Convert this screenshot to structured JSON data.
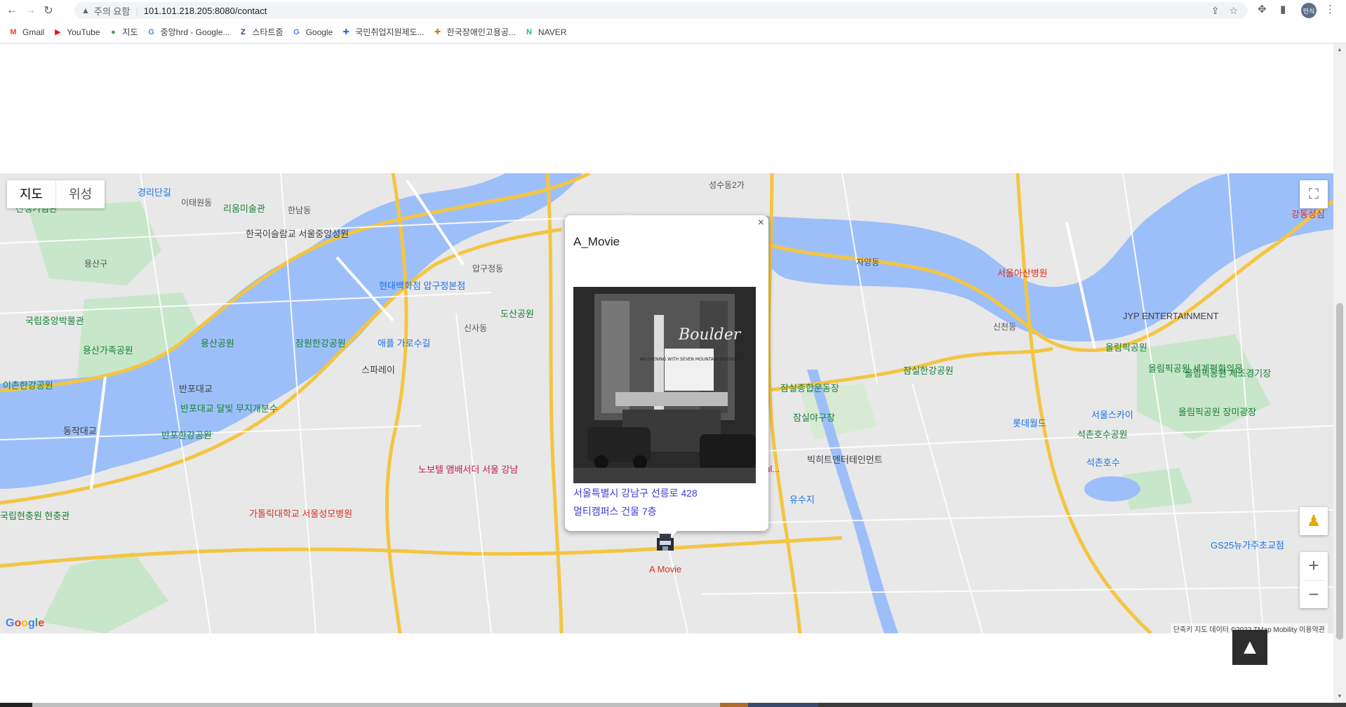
{
  "browser": {
    "security_label": "주의 요함",
    "url": "101.101.218.205:8080/contact",
    "avatar_text": "민식",
    "bookmarks": [
      {
        "label": "Gmail",
        "icon": "gmail-icon",
        "color": "#ea4335",
        "glyph": "M"
      },
      {
        "label": "YouTube",
        "icon": "youtube-icon",
        "color": "#ff0000",
        "glyph": "▶"
      },
      {
        "label": "지도",
        "icon": "maps-icon",
        "color": "#34a853",
        "glyph": "●"
      },
      {
        "label": "중앙hrd - Google...",
        "icon": "google-icon",
        "color": "#4285f4",
        "glyph": "G"
      },
      {
        "label": "스타트줌",
        "icon": "startzoom-icon",
        "color": "#1a3c8c",
        "glyph": "Z"
      },
      {
        "label": "Google",
        "icon": "google-icon",
        "color": "#4285f4",
        "glyph": "G"
      },
      {
        "label": "국민취업지원제도...",
        "icon": "gov-icon",
        "color": "#1a73e8",
        "glyph": "✚"
      },
      {
        "label": "한국장애인고용공...",
        "icon": "kead-icon",
        "color": "#e37400",
        "glyph": "✚"
      },
      {
        "label": "NAVER",
        "icon": "naver-icon",
        "color": "#03c75a",
        "glyph": "N"
      }
    ]
  },
  "map": {
    "type_controls": {
      "map": "지도",
      "satellite": "위성"
    },
    "colors": {
      "water": "#9dbff9",
      "land": "#e8e8e8",
      "park": "#c8e6c9",
      "road_major": "#f4c542",
      "road_minor": "#ffffff"
    },
    "labels": [
      {
        "text": "경리단길",
        "cls": "blue"
      },
      {
        "text": "이태원동",
        "cls": ""
      },
      {
        "text": "리움미술관",
        "cls": "green"
      },
      {
        "text": "전쟁기념관",
        "cls": "green"
      },
      {
        "text": "한국이슬람교 서울중앙성원",
        "cls": "dark"
      },
      {
        "text": "한남동",
        "cls": ""
      },
      {
        "text": "용산구",
        "cls": ""
      },
      {
        "text": "국립중앙박물관",
        "cls": "green"
      },
      {
        "text": "용산공원",
        "cls": "green"
      },
      {
        "text": "용산가족공원",
        "cls": "green"
      },
      {
        "text": "이촌한강공원",
        "cls": "green"
      },
      {
        "text": "잠원한강공원",
        "cls": "green"
      },
      {
        "text": "현대백화점 압구정본점",
        "cls": "blue"
      },
      {
        "text": "도산공원",
        "cls": "green"
      },
      {
        "text": "애플 가로수길",
        "cls": "blue"
      },
      {
        "text": "스파레이",
        "cls": "dark"
      },
      {
        "text": "반포대교 달빛 무지개분수",
        "cls": "green"
      },
      {
        "text": "반포한강공원",
        "cls": "green"
      },
      {
        "text": "동작대교",
        "cls": "dark"
      },
      {
        "text": "반포대교",
        "cls": "dark"
      },
      {
        "text": "노보텔 앰배서더 서울 강남",
        "cls": "pink"
      },
      {
        "text": "Josun Palace, a Luxury Collection Hotel, Seoul...",
        "cls": "pink"
      },
      {
        "text": "가톨릭대학교 서울성모병원",
        "cls": "red"
      },
      {
        "text": "국립현충원 현충관",
        "cls": "green"
      },
      {
        "text": "잠실한강공원",
        "cls": "green"
      },
      {
        "text": "잠실종합운동장",
        "cls": "green"
      },
      {
        "text": "잠실야구장",
        "cls": "green"
      },
      {
        "text": "빅히트엔터테인먼트",
        "cls": "dark"
      },
      {
        "text": "롯데월드",
        "cls": "blue"
      },
      {
        "text": "서울스카이",
        "cls": "blue"
      },
      {
        "text": "석촌호수공원",
        "cls": "green"
      },
      {
        "text": "서울아산병원",
        "cls": "red"
      },
      {
        "text": "JYP ENTERTAINMENT",
        "cls": "dark"
      },
      {
        "text": "올림픽공원",
        "cls": "green"
      },
      {
        "text": "올림픽공원 세계평화의문",
        "cls": "green"
      },
      {
        "text": "올림픽공원 체조경기장",
        "cls": "green"
      },
      {
        "text": "올림픽공원 장미광장",
        "cls": "green"
      },
      {
        "text": "강동성심",
        "cls": "red"
      },
      {
        "text": "GS25뉴가주초교점",
        "cls": "blue"
      },
      {
        "text": "석촌호수",
        "cls": "blue"
      },
      {
        "text": "유수지",
        "cls": "blue"
      },
      {
        "text": "성수동2가",
        "cls": ""
      },
      {
        "text": "자양동",
        "cls": ""
      },
      {
        "text": "신천동",
        "cls": ""
      },
      {
        "text": "압구정동",
        "cls": ""
      },
      {
        "text": "신사동",
        "cls": ""
      }
    ],
    "google_logo": "Google",
    "attribution": "단축키   지도 데이터 ©2022 TMap Mobility   이용약관",
    "marker_label": "A Movie"
  },
  "infowindow": {
    "title": "A_Movie",
    "close": "×",
    "address_line1": "서울특별시 강남구 선릉로 428",
    "address_line2": "멀티캠퍼스 건물 7층",
    "photo_sign": "Boulder",
    "photo_marquee": "AN EVENING WITH SEVEN MOUNTAIN DIVISION"
  },
  "scroll_top": "▲"
}
